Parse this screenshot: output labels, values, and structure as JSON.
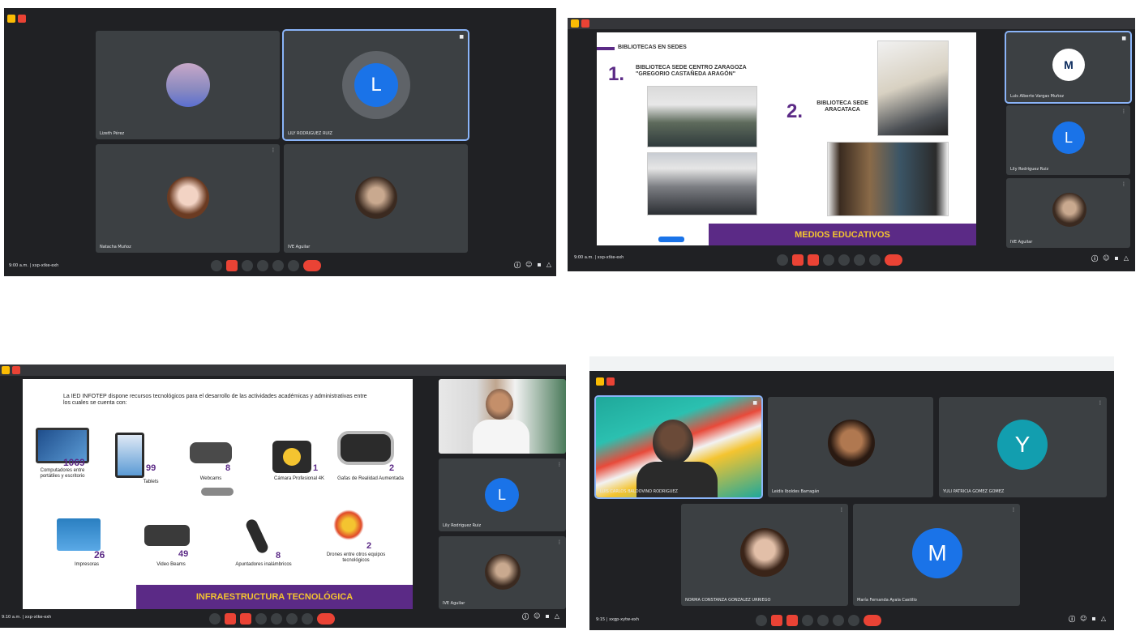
{
  "shot1": {
    "tiles": [
      {
        "name": "Lizeth Pérez",
        "avatar": ""
      },
      {
        "name": "LILY RODRIGUEZ RUIZ",
        "avatar": "L"
      },
      {
        "name": "Natacha Muñoz",
        "avatar": ""
      },
      {
        "name": "IVE Aguilar",
        "avatar": ""
      }
    ],
    "info": "9:00 a.m. | xxp-xtke-exh"
  },
  "shot2": {
    "slide": {
      "section_title": "BIBLIOTECAS EN SEDES",
      "item1_number": "1.",
      "item1_text": "BIBLIOTECA SEDE CENTRO ZARAGOZA \"GREGORIO CASTAÑEDA ARAGÓN\"",
      "item2_number": "2.",
      "item2_text": "BIBLIOTECA SEDE ARACATACA",
      "banner": "MEDIOS EDUCATIVOS"
    },
    "side_tiles": [
      {
        "name": "Luis Alberto Vargas Muñoz",
        "avatar": "M"
      },
      {
        "name": "Lily Rodriguez Ruiz",
        "avatar": "L"
      },
      {
        "name": "IVE Aguilar",
        "avatar": ""
      }
    ],
    "info": "9:00 a.m. | xxp-xtke-exh"
  },
  "shot3": {
    "slide": {
      "intro": "La IED INFOTEP dispone recursos tecnológicos para el desarrollo de las actividades académicas y administrativas entre los cuales se cuenta con:",
      "items": [
        {
          "value": "1069",
          "label": "Computadores entre portátiles y escritorio"
        },
        {
          "value": "99",
          "label": "Tablets"
        },
        {
          "value": "8",
          "label": "Webcams"
        },
        {
          "value": "1",
          "label": "Cámara Profesional 4K"
        },
        {
          "value": "2",
          "label": "Gafas de Realidad Aumentada"
        },
        {
          "value": "26",
          "label": "Impresoras"
        },
        {
          "value": "49",
          "label": "Video Beams"
        },
        {
          "value": "8",
          "label": "Apuntadores inalámbricos"
        },
        {
          "value": "2",
          "label": "Drones entre otros equipos tecnológicos"
        }
      ],
      "banner": "INFRAESTRUCTURA TECNOLÓGICA"
    },
    "side_tiles": [
      {
        "name": "",
        "avatar": ""
      },
      {
        "name": "Lily Rodriguez Ruiz",
        "avatar": "L"
      },
      {
        "name": "IVE Aguilar",
        "avatar": ""
      }
    ],
    "info": "9:10 a.m. | xxp-xtke-exh"
  },
  "shot4": {
    "tiles": [
      {
        "name": "LUIS CARLOS BALDOVINO RODRIGUEZ",
        "avatar": ""
      },
      {
        "name": "Leidis Iboldes Barragán",
        "avatar": ""
      },
      {
        "name": "YULI PATRICIA GOMEZ GOMEZ",
        "avatar": "Y"
      },
      {
        "name": "NORMA CONSTANZA GONZALEZ URRIEGO",
        "avatar": ""
      },
      {
        "name": "María Fernanda Ayala Castillo",
        "avatar": "M"
      }
    ],
    "info": "9:15 | xxgp-xytw-exh"
  },
  "colors": {
    "meet_bg": "#202124",
    "tile_bg": "#3c4043",
    "accent_blue": "#1a73e8",
    "teal": "#129eaf",
    "purple": "#5b2a86",
    "yellow": "#f4c430",
    "hangup_red": "#ea4335"
  }
}
